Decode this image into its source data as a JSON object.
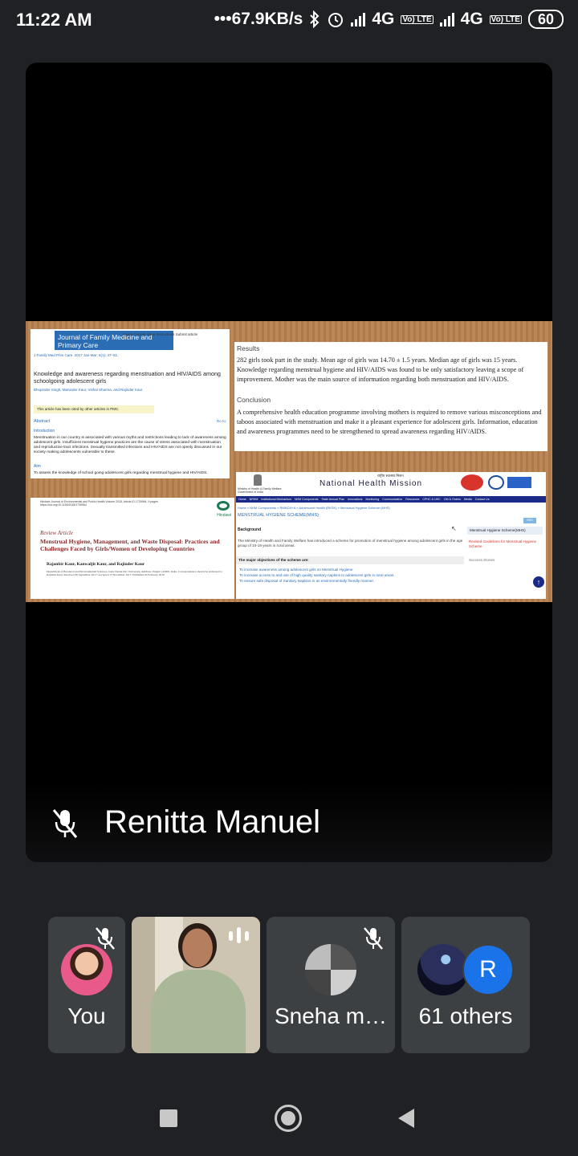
{
  "status_bar": {
    "time": "11:22 AM",
    "net_speed": "•••67.9KB/s",
    "network1": "4G",
    "network2": "4G",
    "volte1": "Vo) LTE",
    "volte2": "Vo) LTE",
    "battery": "60",
    "icons": [
      "bluetooth-icon",
      "alarm-icon",
      "signal-icon",
      "signal-icon",
      "battery-icon"
    ]
  },
  "main_tile": {
    "presenter_name": "Renitta Manuel",
    "mic_state": "muted",
    "slide": {
      "panel1": {
        "journal_title": "Journal of Family Medicine and Primary Care",
        "journal_side": "Home Current issue Instructions Submit article",
        "citation": "J Family Med Prim Care. 2017 Jan-Mar; 6(1): 47–51.",
        "article_title": "Knowledge and awareness regarding menstruation and HIV/AIDS among schoolgoing adolescent girls",
        "authors": "Bhupinder Singh, Maninder Kaur, Vishal Sharma, and Rajinder Kaur",
        "note": "This article has been cited by other articles in PMC.",
        "abstract_label": "Abstract",
        "goto_label": "Go to:",
        "intro_label": "Introduction",
        "intro_text": "Menstruation in our country is associated with various myths and restrictions leading to lack of awareness among adolescent girls. Insufficient menstrual hygiene practices are the cause of stress associated with menstruation and reproductive tract infections. Sexually transmitted infections and HIV/AIDS are not openly discussed in our society making adolescents vulnerable to these.",
        "aim_label": "Aim",
        "aim_text": "To assess the knowledge of school going adolescent girls regarding menstrual hygiene and HIV/AIDS."
      },
      "panel2": {
        "results_heading": "Results",
        "results_text": "282 girls took part in the study. Mean age of girls was 14.70 ± 1.5 years. Median age of girls was 15 years. Knowledge regarding menstrual hygiene and HIV/AIDS was found to be only satisfactory leaving a scope of improvement. Mother was the main source of information regarding both menstruation and HIV/AIDS.",
        "conclusion_heading": "Conclusion",
        "conclusion_text": "A comprehensive health education programme involving mothers is required to remove various misconceptions and taboos associated with menstruation and make it a pleasant experience for adolescent girls. Information, education and awareness programmes need to be strengthened to spread awareness regarding HIV/AIDS."
      },
      "panel3": {
        "small_header": "Hindawi Journal of Environmental and Public Health Volume 2018, Article ID 1730964, 9 pages https://doi.org/10.1155/2018/1730964",
        "logo_text": "Hindawi",
        "article_type": "Review Article",
        "title": "Menstrual Hygiene, Management, and Waste Disposal: Practices and Challenges Faced by Girls/Women of Developing Countries",
        "authors": "Rajanbir Kaur, Kanwaljit Kaur, and Rajinder Kaur",
        "affiliation": "Department of Botanical and Environmental Sciences, Guru Nanak Dev University, Amritsar, Punjab 143005, India. Correspondence should be addressed to Rajinder Kaur. Received 30 September 2017; Accepted 13 November 2017; Published 20 February 2018"
      },
      "panel4": {
        "ministry": "Ministry of Health & Family Welfare Government of India",
        "hindi": "राष्ट्रीय स्वास्थ्य मिशन",
        "title": "National Health Mission",
        "nav_items": [
          "Home",
          "NRHM",
          "Institutional Mechanism",
          "NHM Components",
          "State Annual Plan",
          "Innovations",
          "Monitoring",
          "Communication",
          "Resources",
          "CPHC & UHC",
          "OM & Orders",
          "Media",
          "Contact Us"
        ],
        "breadcrumb": "Home » NHM Components » RMNCH+A » Adolescent Health (RKSK) » Menstrual Hygiene Scheme (MHS)",
        "section_title": "MENSTRUAL HYGIENE SCHEME(MHS)",
        "rss": "RSS",
        "background_label": "Background",
        "background_text": "The Ministry of Health and Family Welfare has introduced a scheme for promotion of menstrual hygiene among adolescent girls in the age group of 10-19 years in rural areas.",
        "side_heading": "Menstrual Hygiene Scheme(MHS)",
        "side_link": "Revised Guidelines for Menstrual Hygiene Scheme",
        "side_sub": "Success Stories",
        "objectives_heading": "The major objectives of the scheme are:",
        "objectives": [
          "To increase awareness among adolescent girls on Menstrual Hygiene",
          "To increase access to and use of high quality sanitary napkins to adolescent girls in rural areas.",
          "To ensure safe disposal of Sanitary Napkins in an environmentally friendly manner."
        ]
      }
    }
  },
  "participants": [
    {
      "label": "You",
      "mic_state": "muted"
    },
    {
      "label": "",
      "mic_state": "speaking"
    },
    {
      "label": "Sneha m…",
      "mic_state": "muted"
    },
    {
      "label": "61 others",
      "avatar_letter": "R"
    }
  ],
  "nav_bar": {
    "buttons": [
      "recent-apps",
      "home",
      "back"
    ]
  },
  "colors": {
    "background": "#202124",
    "tile": "#3c4043",
    "accent_blue": "#1a73e8",
    "slide_wood": "#b9814f"
  }
}
